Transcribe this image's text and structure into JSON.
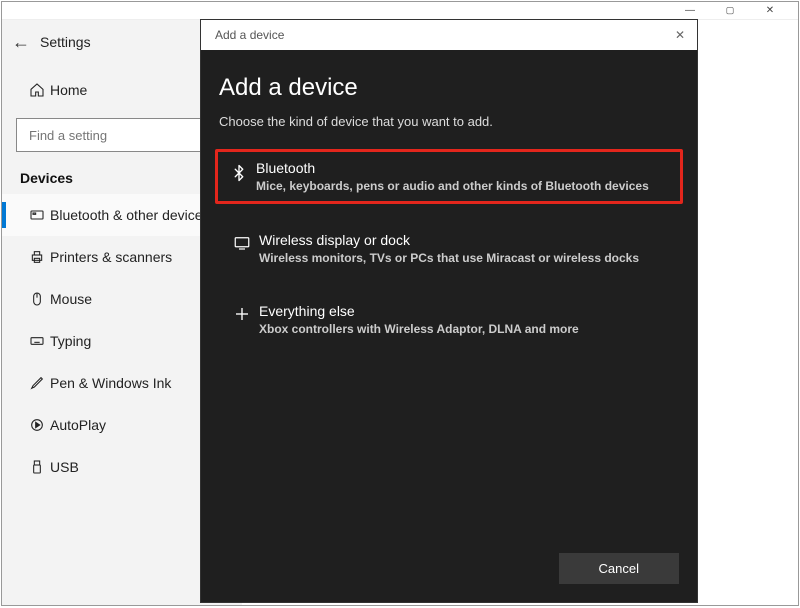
{
  "window": {
    "title": "Settings",
    "min_label": "—",
    "max_label": "▢",
    "close_label": "✕"
  },
  "sidebar": {
    "home_label": "Home",
    "search_placeholder": "Find a setting",
    "category": "Devices",
    "items": [
      {
        "label": "Bluetooth & other devices",
        "active": true
      },
      {
        "label": "Printers & scanners"
      },
      {
        "label": "Mouse"
      },
      {
        "label": "Typing"
      },
      {
        "label": "Pen & Windows Ink"
      },
      {
        "label": "AutoPlay"
      },
      {
        "label": "USB"
      }
    ]
  },
  "modal": {
    "titlebar": "Add a device",
    "close": "✕",
    "heading": "Add a device",
    "subtext": "Choose the kind of device that you want to add.",
    "options": [
      {
        "title": "Bluetooth",
        "desc": "Mice, keyboards, pens or audio and other kinds of Bluetooth devices",
        "highlighted": true
      },
      {
        "title": "Wireless display or dock",
        "desc": "Wireless monitors, TVs or PCs that use Miracast or wireless docks"
      },
      {
        "title": "Everything else",
        "desc": "Xbox controllers with Wireless Adaptor, DLNA and more"
      }
    ],
    "cancel": "Cancel"
  }
}
